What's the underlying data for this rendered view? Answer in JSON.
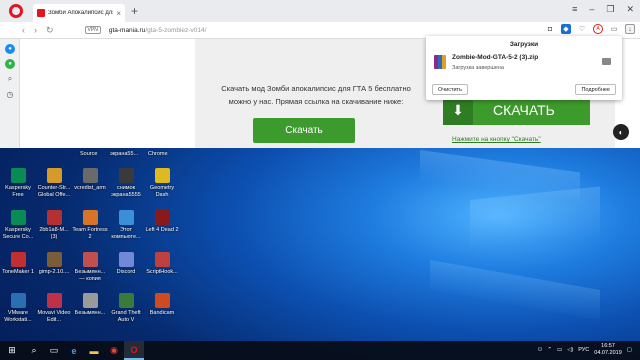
{
  "browser": {
    "tab_title": "Зомби Апокалипсис для",
    "url_host": "gta-mania.ru",
    "url_path": "/gta-5-zombiez-v014/",
    "vpn": "VPN"
  },
  "page": {
    "promo_text": "Скачать мод Зомби апокалипсис для ГТА 5 бесплатно можно у нас. Прямая ссылка на скачивание ниже:",
    "download_button": "Скачать",
    "big_download_button": "СКАЧАТЬ",
    "click_link": "Нажмите на кнопку \"Скачать\""
  },
  "downloads_panel": {
    "title": "Загрузки",
    "file_name": "Zombie-Mod-GTA-5-2 (3).zip",
    "status": "Загрузка завершена",
    "clear_button": "Очистить",
    "more_button": "Подробнее"
  },
  "desktop": {
    "top_captions": [
      "Source",
      "экрана55...",
      "Chrome"
    ],
    "icons": [
      {
        "label": "Kaspersky Free",
        "color": "#0a8a55"
      },
      {
        "label": "Counter-Str... Global Offe...",
        "color": "#d59a2a"
      },
      {
        "label": "vcredist_arm",
        "color": "#6a6a6a"
      },
      {
        "label": "снимок экрана5555",
        "color": "#3a3a3a"
      },
      {
        "label": "Geometry Dash",
        "color": "#e0b820"
      },
      {
        "label": "Kaspersky Secure Co...",
        "color": "#0a8a55"
      },
      {
        "label": "2bb1a8-M... (3)",
        "color": "#b53030"
      },
      {
        "label": "Team Fortress 2",
        "color": "#d8742a"
      },
      {
        "label": "Этот компьюте...",
        "color": "#3b8fd8"
      },
      {
        "label": "Left 4 Dead 2",
        "color": "#8a1a1a"
      },
      {
        "label": "ToneMaker 1",
        "color": "#c03030"
      },
      {
        "label": "gimp-2.10....",
        "color": "#7a5c3a"
      },
      {
        "label": "Безымянн... — копия",
        "color": "#c05050"
      },
      {
        "label": "Discord",
        "color": "#7289da"
      },
      {
        "label": "ScriptHook...",
        "color": "#c04040"
      },
      {
        "label": "VMware Workstati...",
        "color": "#2a6fb0"
      },
      {
        "label": "Movavi Video Edit...",
        "color": "#c03048"
      },
      {
        "label": "Безымянн...",
        "color": "#9a9a9a"
      },
      {
        "label": "Grand Theft Auto V",
        "color": "#3a7a3a"
      },
      {
        "label": "Bandicam",
        "color": "#d04a20"
      }
    ]
  },
  "taskbar": {
    "lang": "РУС",
    "time": "16:57",
    "date": "04.07.2019"
  }
}
